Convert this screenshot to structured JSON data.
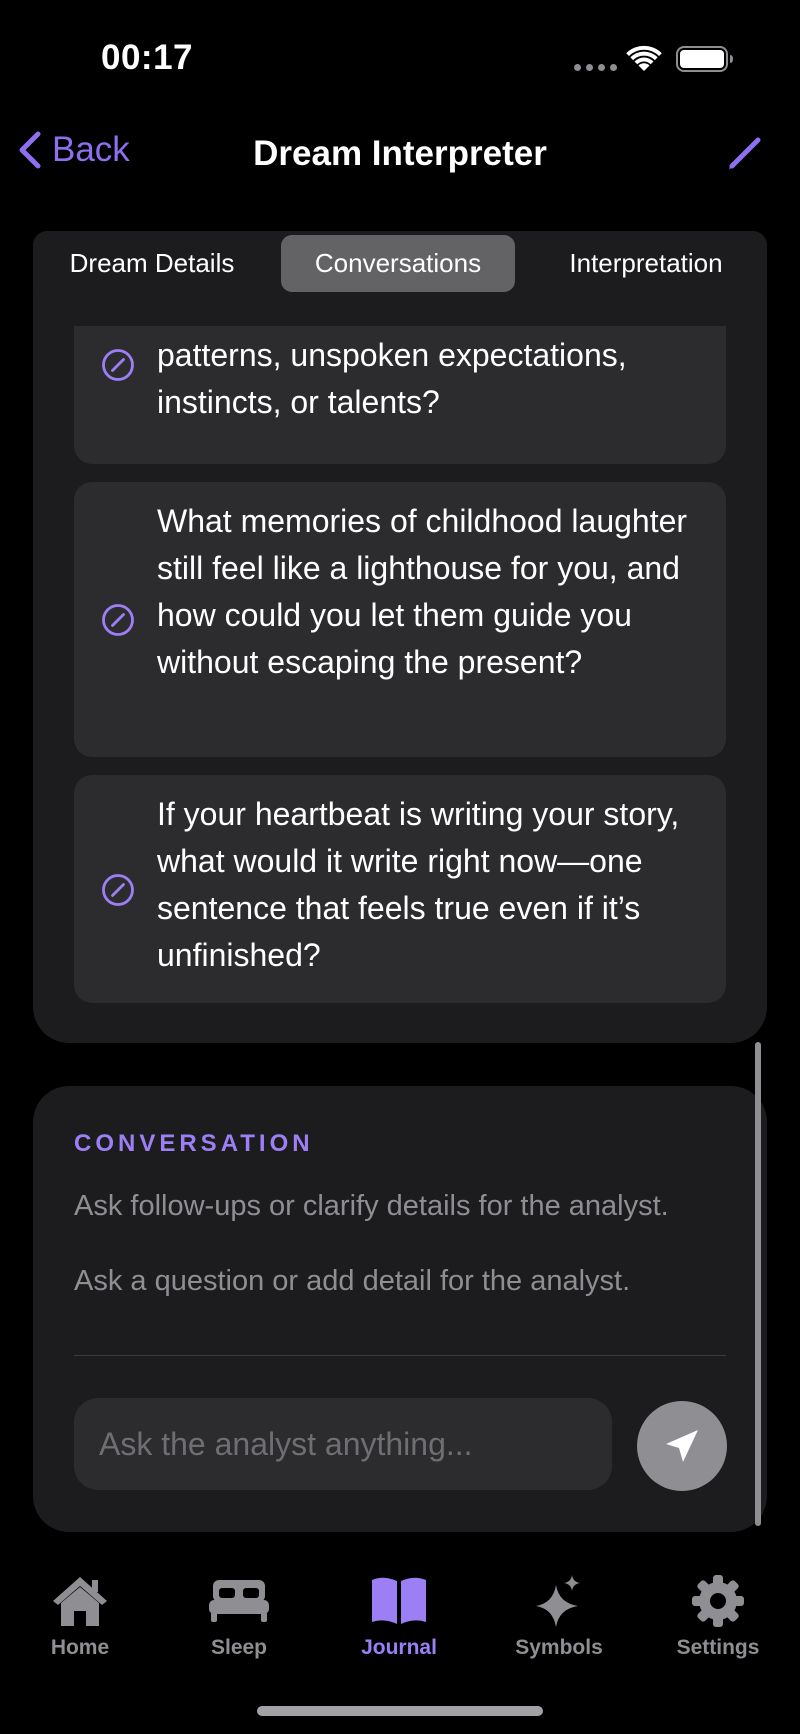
{
  "status": {
    "time": "00:17"
  },
  "nav": {
    "back_label": "Back",
    "title": "Dream Interpreter"
  },
  "tabs": [
    {
      "label": "Dream Details",
      "active": false
    },
    {
      "label": "Conversations",
      "active": true
    },
    {
      "label": "Interpretation",
      "active": false
    }
  ],
  "questions": [
    {
      "text": "that you still seem to carry—family patterns, unspoken expectations, instincts, or talents?"
    },
    {
      "text": "What memories of childhood laughter still feel like a lighthouse for you, and how could you let them guide you without escaping the present?"
    },
    {
      "text": "If your heartbeat is writing your story, what would it write right now—one sentence that feels true even if it’s unfinished?"
    }
  ],
  "conversation": {
    "heading": "CONVERSATION",
    "subtitle": "Ask follow-ups or clarify details for the analyst.",
    "hint": "Ask a question or add detail for the analyst.",
    "input_placeholder": "Ask the analyst anything..."
  },
  "tab_bar": [
    {
      "label": "Home",
      "icon": "house-icon",
      "active": false
    },
    {
      "label": "Sleep",
      "icon": "bed-icon",
      "active": false
    },
    {
      "label": "Journal",
      "icon": "book-icon",
      "active": true
    },
    {
      "label": "Symbols",
      "icon": "sparkles-icon",
      "active": false
    },
    {
      "label": "Settings",
      "icon": "gear-icon",
      "active": false
    }
  ],
  "colors": {
    "accent": "#9d7ff5",
    "card": "#1c1c1e",
    "item": "#2c2c2e",
    "muted": "#8e8e93"
  }
}
